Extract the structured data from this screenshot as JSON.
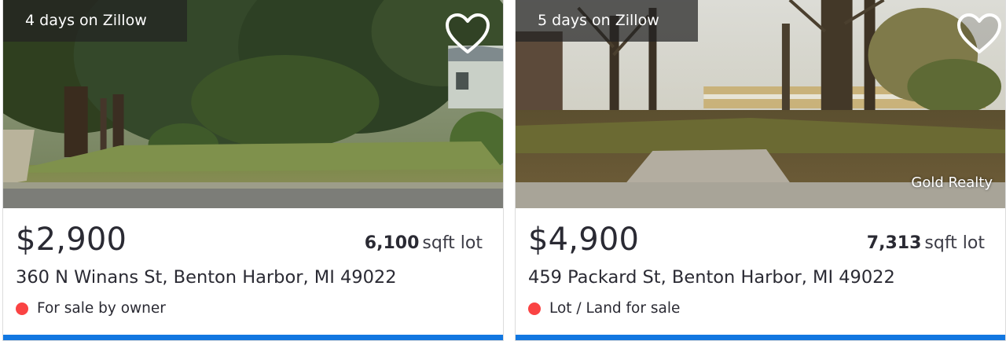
{
  "colors": {
    "accent_bar": "#1277e1",
    "status_dot": "#fa4343",
    "badge_bg": "rgba(34,34,34,0.72)",
    "text_primary": "#2a2a33"
  },
  "listings": [
    {
      "days_on_site": "4 days on Zillow",
      "favorite_icon": "heart-outline-icon",
      "price": "$2,900",
      "lot_size": "6,100",
      "lot_unit": "sqft lot",
      "address": "360 N Winans St, Benton Harbor, MI 49022",
      "status": "For sale by owner",
      "watermark": ""
    },
    {
      "days_on_site": "5 days on Zillow",
      "favorite_icon": "heart-outline-icon",
      "price": "$4,900",
      "lot_size": "7,313",
      "lot_unit": "sqft lot",
      "address": "459 Packard St, Benton Harbor, MI 49022",
      "status": "Lot / Land for sale",
      "watermark": "Gold Realty"
    }
  ]
}
